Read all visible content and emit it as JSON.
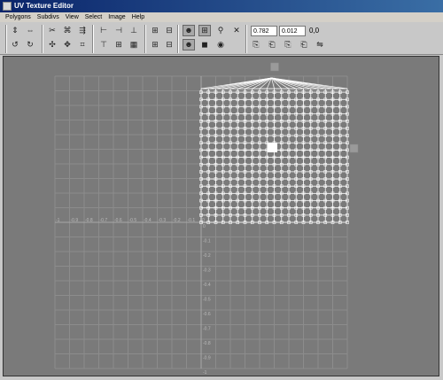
{
  "window": {
    "title": "UV Texture Editor"
  },
  "menu": [
    "Polygons",
    "Subdivs",
    "View",
    "Select",
    "Image",
    "Help"
  ],
  "toolbar": {
    "u_value": "0.782",
    "v_value": "0.012",
    "zero_label": "0,0",
    "buttons_row1": [
      {
        "name": "flip-u-icon",
        "glyph": "⇕"
      },
      {
        "name": "flip-v-icon",
        "glyph": "⇔"
      },
      {
        "name": "cut-uv-icon",
        "glyph": "✂"
      },
      {
        "name": "sew-uv-icon",
        "glyph": "⌘"
      },
      {
        "name": "move-sew-icon",
        "glyph": "⇶"
      },
      {
        "name": "align-left-icon",
        "glyph": "⊢"
      },
      {
        "name": "align-right-icon",
        "glyph": "⊣"
      },
      {
        "name": "align-bottom-icon",
        "glyph": "⊥"
      },
      {
        "name": "grid-uv-icon",
        "glyph": "⊞"
      },
      {
        "name": "layout-uv-icon",
        "glyph": "⊟"
      },
      {
        "name": "toggle-shaded-icon",
        "glyph": "☻"
      },
      {
        "name": "toggle-grid-icon",
        "glyph": "⊞"
      },
      {
        "name": "snap-icon",
        "glyph": "⚲"
      },
      {
        "name": "pin-icon",
        "glyph": "✕"
      }
    ],
    "buttons_row2": [
      {
        "name": "rotate-ccw-icon",
        "glyph": "↺"
      },
      {
        "name": "rotate-cw-icon",
        "glyph": "↻"
      },
      {
        "name": "unfold-icon",
        "glyph": "✣"
      },
      {
        "name": "relax-icon",
        "glyph": "✥"
      },
      {
        "name": "smudge-icon",
        "glyph": "⌗"
      },
      {
        "name": "align-top-icon",
        "glyph": "⊤"
      },
      {
        "name": "grid-snap-icon",
        "glyph": "⊞"
      },
      {
        "name": "layout-icon",
        "glyph": "▦"
      },
      {
        "name": "image-range-icon",
        "glyph": "⊞"
      },
      {
        "name": "image-ratio-icon",
        "glyph": "⊟"
      },
      {
        "name": "texture-display-icon",
        "glyph": "☻"
      },
      {
        "name": "dim-image-icon",
        "glyph": "◼"
      },
      {
        "name": "checker-icon",
        "glyph": "◉"
      },
      {
        "name": "copy-uv-icon",
        "glyph": "⎘"
      },
      {
        "name": "paste-uv-icon",
        "glyph": "⎗"
      },
      {
        "name": "paste-u-icon",
        "glyph": "⎘"
      },
      {
        "name": "paste-v-icon",
        "glyph": "⎗"
      },
      {
        "name": "cycle-uv-icon",
        "glyph": "⇋"
      }
    ]
  },
  "viewport": {
    "bg": "#7a7a7a",
    "grid_color": "#8c8c8c",
    "mesh_color": "#ffffff",
    "axis_labels_x": [
      "-1",
      "-0.9",
      "-0.8",
      "-0.7",
      "-0.6",
      "-0.5",
      "-0.4",
      "-0.3",
      "-0.2",
      "-0.1",
      "0"
    ],
    "axis_labels_y": [
      "0",
      "-0.1",
      "-0.2",
      "-0.3",
      "-0.4",
      "-0.5",
      "-0.6",
      "-0.7",
      "-0.8",
      "-0.9",
      "-1"
    ]
  }
}
